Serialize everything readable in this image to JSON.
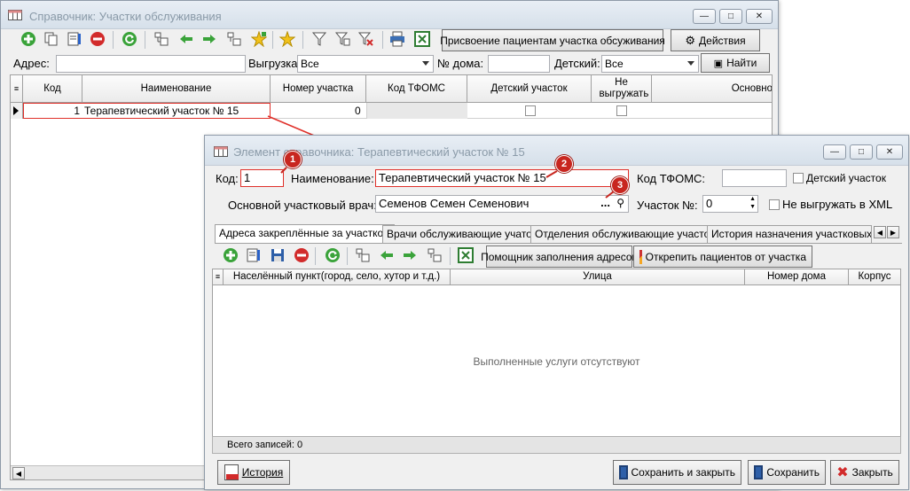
{
  "bg_window": {
    "title": "Справочник: Участки обслуживания",
    "toolbar": {
      "assign_button": "Присвоение пациентам участка обсуживания",
      "actions_button": "Действия"
    },
    "filter": {
      "address_label": "Адрес:",
      "address_value": "",
      "export_label": "Выгрузка:",
      "export_value": "Все",
      "house_label": "№ дома:",
      "house_value": "",
      "kids_label": "Детский:",
      "kids_value": "Все",
      "find_button": "Найти"
    },
    "columns": [
      "Код",
      "Наименование",
      "Номер участка",
      "Код ТФОМС",
      "Детский участок",
      "Не выгружать",
      "Основно"
    ],
    "row": {
      "code": "1",
      "name": "Терапевтический участок № 15",
      "number": "0",
      "tfoms": "",
      "kids": false,
      "no_export": false
    }
  },
  "fg_window": {
    "title": "Элемент справочника: Терапевтический участок № 15",
    "fields": {
      "code_label": "Код:",
      "code_value": "1",
      "name_label": "Наименование:",
      "name_value": "Терапевтический участок № 15",
      "tfoms_label": "Код ТФОМС:",
      "tfoms_value": "",
      "kids_label": "Детский участок",
      "doctor_label": "Основной участковый врач:",
      "doctor_value": "Семенов Семен Семенович",
      "doctor_dots": "...",
      "section_label": "Участок №:",
      "section_value": "0",
      "no_xml_label": "Не выгружать в XML"
    },
    "badges": [
      "1",
      "2",
      "3"
    ],
    "tabs": [
      "Адреса закреплённые за участком",
      "Врачи обслуживающие учаток",
      "Отделения обслуживающие участок",
      "История назначения участковых вр"
    ],
    "toolbar": {
      "fill_helper": "Помощник заполнения адресов",
      "unpin": "Открепить пациентов от участка"
    },
    "columns": [
      "Населённый пункт(город, село, хутор и т.д.)",
      "Улица",
      "Номер дома",
      "Корпус"
    ],
    "empty_text": "Выполненные услуги отсутствуют",
    "total_records": "Всего записей: 0",
    "footer": {
      "history": "История",
      "save_close": "Сохранить и закрыть",
      "save": "Сохранить",
      "close": "Закрыть"
    }
  },
  "colors": {
    "accent_red": "#e0302a",
    "badge_red": "#c8261f",
    "title_gray": "#8a9aa8"
  }
}
